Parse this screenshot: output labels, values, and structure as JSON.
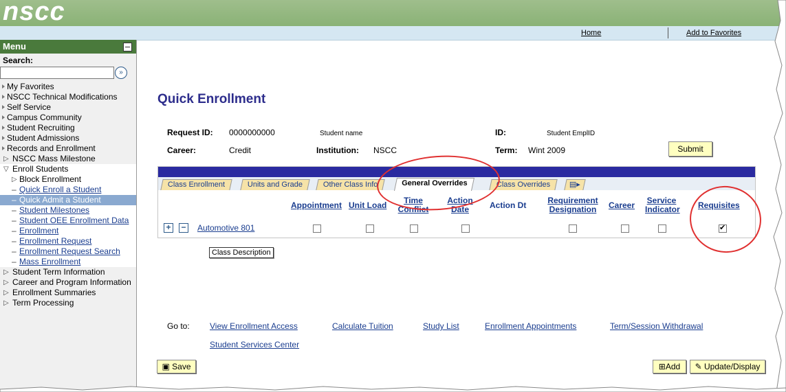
{
  "header": {
    "logo": "nscc",
    "links": {
      "home": "Home",
      "favorites": "Add to Favorites"
    }
  },
  "menu": {
    "title": "Menu",
    "search_label": "Search:",
    "search_value": "",
    "items": {
      "my_favorites": "My Favorites",
      "nscc_tech": "NSCC Technical Modifications",
      "self_service": "Self Service",
      "campus_community": "Campus Community",
      "student_recruiting": "Student Recruiting",
      "student_admissions": "Student Admissions",
      "records_enrollment": "Records and Enrollment",
      "nscc_mass_milestone": "NSCC Mass Milestone",
      "enroll_students": "Enroll Students",
      "block_enrollment": "Block Enrollment",
      "quick_enroll": "Quick Enroll a Student",
      "quick_admit": "Quick Admit a Student",
      "student_milestones": "Student Milestones",
      "student_oee": "Student OEE Enrollment Data",
      "enrollment": "Enrollment",
      "enrollment_request": "Enrollment Request",
      "enrollment_request_search": "Enrollment Request Search",
      "mass_enrollment": "Mass Enrollment",
      "student_term_info": "Student Term Information",
      "career_program": "Career and Program Information",
      "enrollment_summaries": "Enrollment Summaries",
      "term_processing": "Term Processing"
    }
  },
  "page": {
    "title": "Quick Enrollment",
    "request_id_label": "Request ID:",
    "request_id": "0000000000",
    "student_name": "Student name",
    "id_label": "ID:",
    "id_value": "Student EmplID",
    "career_label": "Career:",
    "career": "Credit",
    "institution_label": "Institution:",
    "institution": "NSCC",
    "term_label": "Term:",
    "term": "Wint 2009",
    "submit": "Submit"
  },
  "tabs": [
    "Class Enrollment",
    "Units and Grade",
    "Other Class Info",
    "General Overrides",
    "Class Overrides"
  ],
  "grid": {
    "headers": {
      "appointment": "Appointment",
      "unit_load": "Unit Load",
      "time_conflict": "Time Conflict",
      "action_date": "Action Date",
      "action_dt": "Action Dt",
      "requirement": "Requirement Designation",
      "career": "Career",
      "service": "Service Indicator",
      "requisites": "Requisites"
    },
    "row": {
      "class": "Automotive 801",
      "requisites_checked": true
    }
  },
  "tooltip": "Class Description",
  "goto": {
    "label": "Go to:",
    "links": {
      "view_access": "View Enrollment Access",
      "calc_tuition": "Calculate Tuition",
      "study_list": "Study List",
      "appointments": "Enrollment Appointments",
      "withdrawal": "Term/Session Withdrawal",
      "services": "Student Services Center"
    }
  },
  "footer": {
    "save": "Save",
    "add": "Add",
    "update": "Update/Display"
  },
  "colors": {
    "title": "#2d2d8c",
    "link": "#1a3d8f",
    "annotation": "#e03030",
    "grid_bar": "#2a2aa0"
  }
}
